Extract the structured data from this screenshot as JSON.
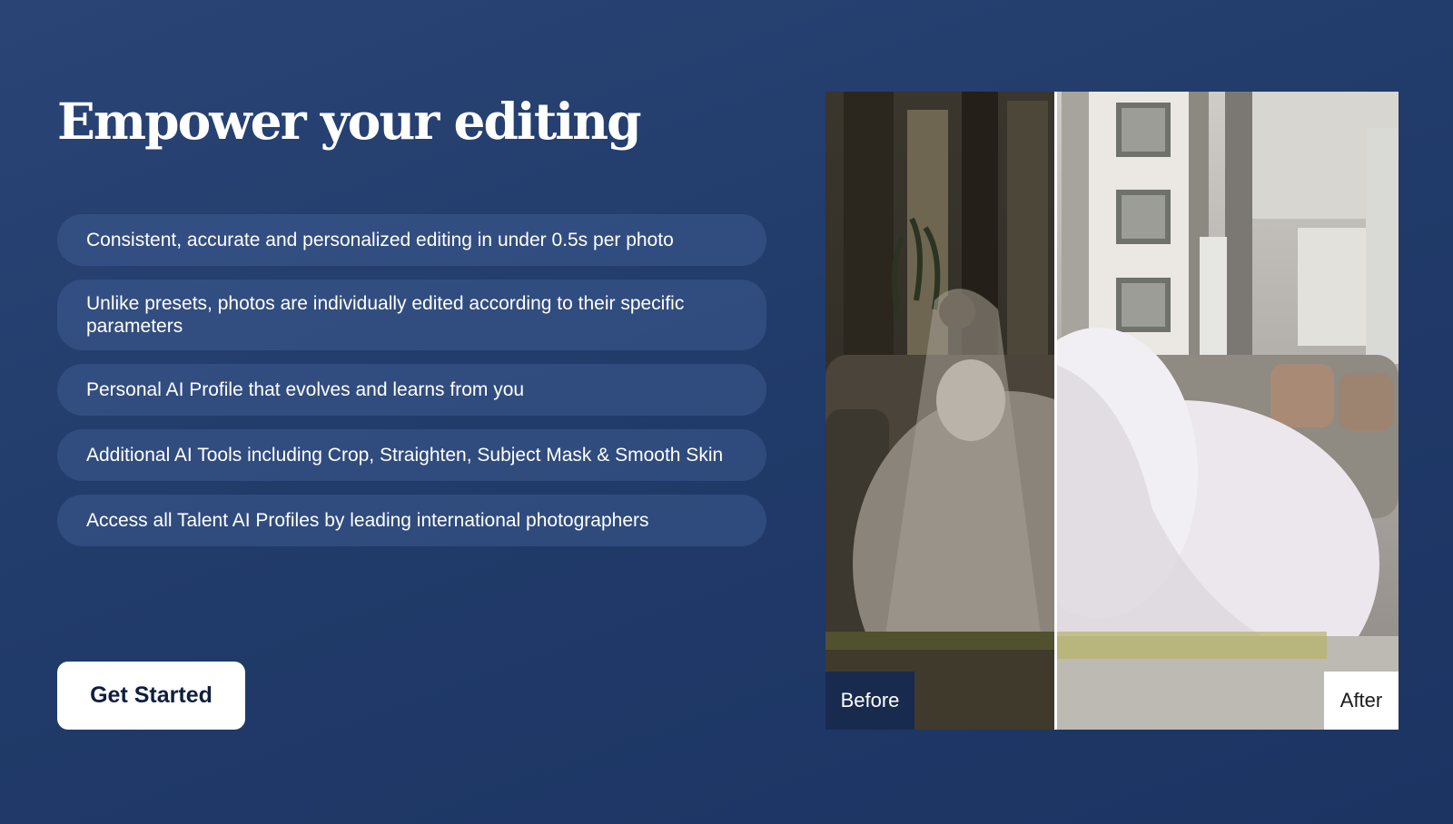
{
  "headline": "Empower your editing",
  "features": [
    "Consistent, accurate and personalized editing in under 0.5s per photo",
    "Unlike presets, photos are individually edited according to their specific parameters",
    "Personal AI Profile that evolves and learns from you",
    "Additional AI Tools including Crop, Straighten, Subject Mask & Smooth Skin",
    "Access all Talent AI Profiles by leading international photographers"
  ],
  "cta": {
    "label": "Get Started"
  },
  "comparison": {
    "before_label": "Before",
    "after_label": "After",
    "split_fraction": 0.4
  },
  "colors": {
    "background": "#213b6a",
    "feature_pill": "#3b5a91",
    "cta_background": "#ffffff",
    "cta_text": "#0f1f3d",
    "before_badge": "#182b4f"
  }
}
